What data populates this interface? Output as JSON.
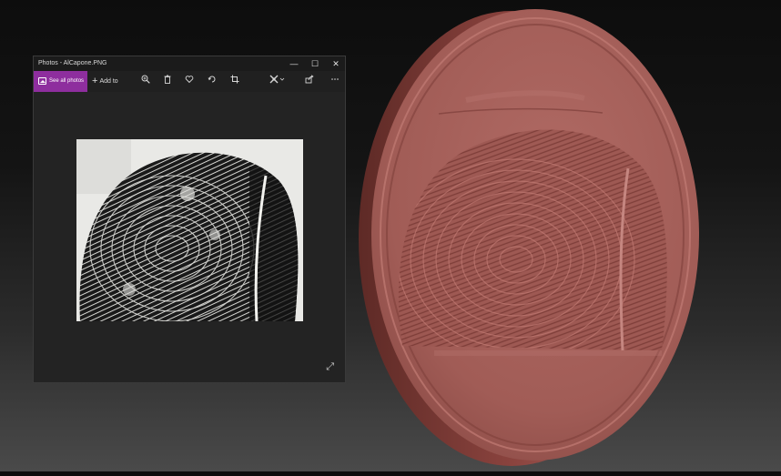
{
  "window": {
    "title": "Photos - AlCapone.PNG",
    "controls": {
      "minimize": "—",
      "maximize": "☐",
      "close": "✕"
    }
  },
  "toolbar": {
    "see_all_label": "See all photos",
    "add_to_label": "Add to",
    "icons": [
      "zoom-in-icon",
      "delete-icon",
      "favorite-icon",
      "rotate-icon",
      "crop-icon",
      "edit-create-icon",
      "share-icon",
      "more-icon"
    ]
  },
  "colors": {
    "accent": "#8e2e9e",
    "window_bg": "#232323",
    "model_surface": "#a9645e",
    "model_rim": "#7f3c37"
  }
}
